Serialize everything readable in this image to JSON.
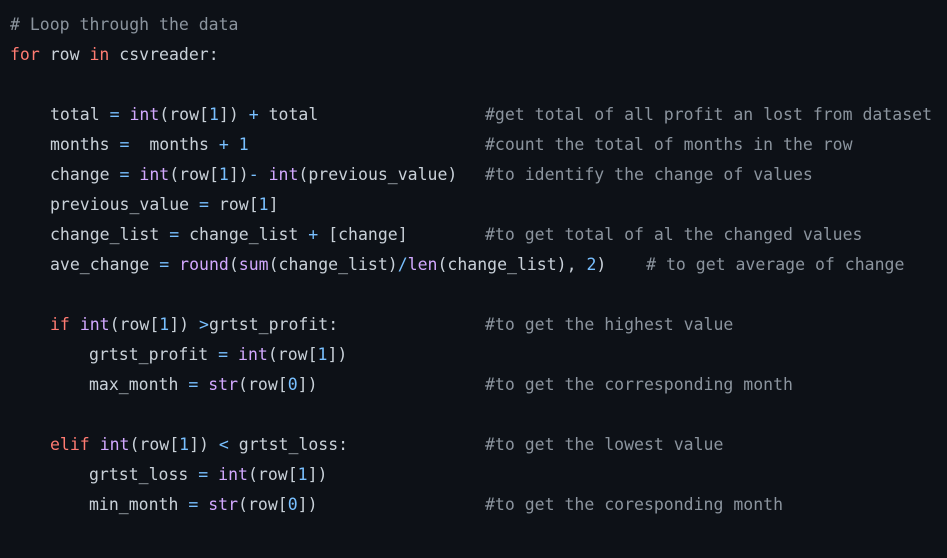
{
  "theme": {
    "background": "#0d1117",
    "text": "#c9d1d9",
    "keyword": "#ff7b72",
    "function": "#d2a8ff",
    "number": "#79c0ff",
    "comment": "#8b949e"
  },
  "lines": [
    {
      "indent": 0,
      "tokens": [
        [
          "cm",
          "# Loop through the data"
        ]
      ]
    },
    {
      "indent": 0,
      "tokens": [
        [
          "kw",
          "for"
        ],
        [
          "id",
          " row "
        ],
        [
          "kw",
          "in"
        ],
        [
          "id",
          " csvreader:"
        ]
      ]
    },
    {
      "indent": 0,
      "tokens": []
    },
    {
      "indent": 1,
      "tokens": [
        [
          "id",
          "total "
        ],
        [
          "op",
          "="
        ],
        [
          "id",
          " "
        ],
        [
          "fn",
          "int"
        ],
        [
          "id",
          "(row["
        ],
        [
          "num",
          "1"
        ],
        [
          "id",
          "]) "
        ],
        [
          "op",
          "+"
        ],
        [
          "id",
          " total"
        ]
      ],
      "comment": "#get total of all profit an lost from dataset"
    },
    {
      "indent": 1,
      "tokens": [
        [
          "id",
          "months "
        ],
        [
          "op",
          "="
        ],
        [
          "id",
          "  months "
        ],
        [
          "op",
          "+"
        ],
        [
          "id",
          " "
        ],
        [
          "num",
          "1"
        ]
      ],
      "comment": "#count the total of months in the row"
    },
    {
      "indent": 1,
      "tokens": [
        [
          "id",
          "change "
        ],
        [
          "op",
          "="
        ],
        [
          "id",
          " "
        ],
        [
          "fn",
          "int"
        ],
        [
          "id",
          "(row["
        ],
        [
          "num",
          "1"
        ],
        [
          "id",
          "])"
        ],
        [
          "op",
          "-"
        ],
        [
          "id",
          " "
        ],
        [
          "fn",
          "int"
        ],
        [
          "id",
          "(previous_value)"
        ]
      ],
      "comment": "#to identify the change of values"
    },
    {
      "indent": 1,
      "tokens": [
        [
          "id",
          "previous_value "
        ],
        [
          "op",
          "="
        ],
        [
          "id",
          " row["
        ],
        [
          "num",
          "1"
        ],
        [
          "id",
          "]"
        ]
      ]
    },
    {
      "indent": 1,
      "tokens": [
        [
          "id",
          "change_list "
        ],
        [
          "op",
          "="
        ],
        [
          "id",
          " change_list "
        ],
        [
          "op",
          "+"
        ],
        [
          "id",
          " [change]"
        ]
      ],
      "comment": "#to get total of al the changed values"
    },
    {
      "indent": 1,
      "tokens": [
        [
          "id",
          "ave_change "
        ],
        [
          "op",
          "="
        ],
        [
          "id",
          " "
        ],
        [
          "fn",
          "round"
        ],
        [
          "id",
          "("
        ],
        [
          "fn",
          "sum"
        ],
        [
          "id",
          "(change_list)"
        ],
        [
          "op",
          "/"
        ],
        [
          "fn",
          "len"
        ],
        [
          "id",
          "(change_list), "
        ],
        [
          "num",
          "2"
        ],
        [
          "id",
          ")    "
        ],
        [
          "cm",
          "# to get average of change"
        ]
      ]
    },
    {
      "indent": 0,
      "tokens": []
    },
    {
      "indent": 1,
      "tokens": [
        [
          "kw",
          "if"
        ],
        [
          "id",
          " "
        ],
        [
          "fn",
          "int"
        ],
        [
          "id",
          "(row["
        ],
        [
          "num",
          "1"
        ],
        [
          "id",
          "]) "
        ],
        [
          "op",
          ">"
        ],
        [
          "id",
          "grtst_profit:"
        ]
      ],
      "comment": "#to get the highest value"
    },
    {
      "indent": 2,
      "tokens": [
        [
          "id",
          "grtst_profit "
        ],
        [
          "op",
          "="
        ],
        [
          "id",
          " "
        ],
        [
          "fn",
          "int"
        ],
        [
          "id",
          "(row["
        ],
        [
          "num",
          "1"
        ],
        [
          "id",
          "])"
        ]
      ]
    },
    {
      "indent": 2,
      "tokens": [
        [
          "id",
          "max_month "
        ],
        [
          "op",
          "="
        ],
        [
          "id",
          " "
        ],
        [
          "fn",
          "str"
        ],
        [
          "id",
          "(row["
        ],
        [
          "num",
          "0"
        ],
        [
          "id",
          "])"
        ]
      ],
      "comment": "#to get the corresponding month"
    },
    {
      "indent": 0,
      "tokens": []
    },
    {
      "indent": 1,
      "tokens": [
        [
          "kw",
          "elif"
        ],
        [
          "id",
          " "
        ],
        [
          "fn",
          "int"
        ],
        [
          "id",
          "(row["
        ],
        [
          "num",
          "1"
        ],
        [
          "id",
          "]) "
        ],
        [
          "op",
          "<"
        ],
        [
          "id",
          " grtst_loss:"
        ]
      ],
      "comment": "#to get the lowest value"
    },
    {
      "indent": 2,
      "tokens": [
        [
          "id",
          "grtst_loss "
        ],
        [
          "op",
          "="
        ],
        [
          "id",
          " "
        ],
        [
          "fn",
          "int"
        ],
        [
          "id",
          "(row["
        ],
        [
          "num",
          "1"
        ],
        [
          "id",
          "])"
        ]
      ]
    },
    {
      "indent": 2,
      "tokens": [
        [
          "id",
          "min_month "
        ],
        [
          "op",
          "="
        ],
        [
          "id",
          " "
        ],
        [
          "fn",
          "str"
        ],
        [
          "id",
          "(row["
        ],
        [
          "num",
          "0"
        ],
        [
          "id",
          "])"
        ]
      ],
      "comment": "#to get the coresponding month"
    }
  ]
}
